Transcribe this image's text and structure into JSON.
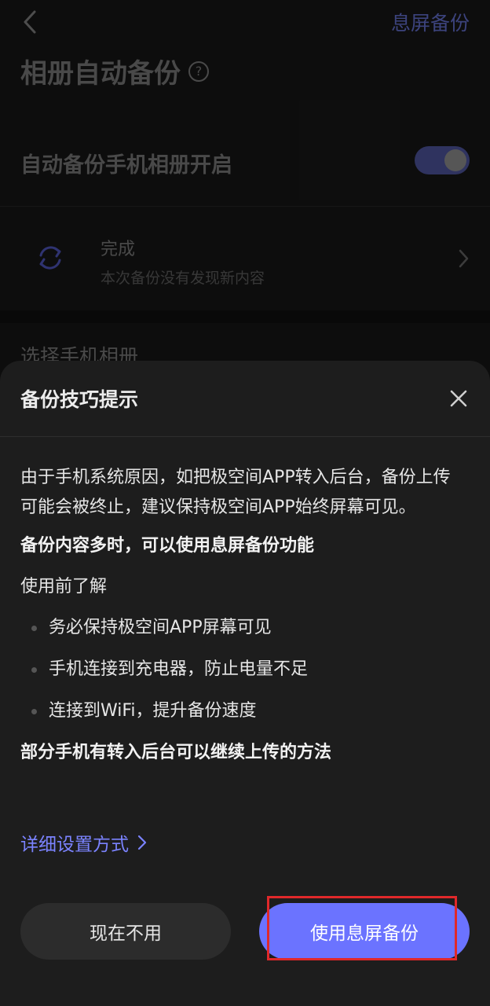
{
  "header": {
    "back_icon": "chevron-left-icon",
    "action_label": "息屏备份"
  },
  "page": {
    "title": "相册自动备份",
    "help_icon_glyph": "?"
  },
  "auto_backup": {
    "label": "自动备份手机相册开启",
    "enabled": true
  },
  "status": {
    "title": "完成",
    "subtitle": "本次备份没有发现新内容"
  },
  "section": {
    "label": "选择手机相册"
  },
  "sheet": {
    "title": "备份技巧提示",
    "intro": "由于手机系统原因，如把极空间APP转入后台，备份上传可能会被终止，建议保持极空间APP始终屏幕可见。",
    "tip_heading": "备份内容多时，可以使用息屏备份功能",
    "before_use": "使用前了解",
    "bullets": [
      "务必保持极空间APP屏幕可见",
      "手机连接到充电器，防止电量不足",
      "连接到WiFi，提升备份速度"
    ],
    "background_heading": "部分手机有转入后台可以继续上传的方法",
    "link_label": "详细设置方式",
    "secondary_button": "现在不用",
    "primary_button": "使用息屏备份"
  },
  "colors": {
    "accent": "#6b73ff",
    "link": "#7b83ff",
    "highlight": "#e0282a"
  }
}
